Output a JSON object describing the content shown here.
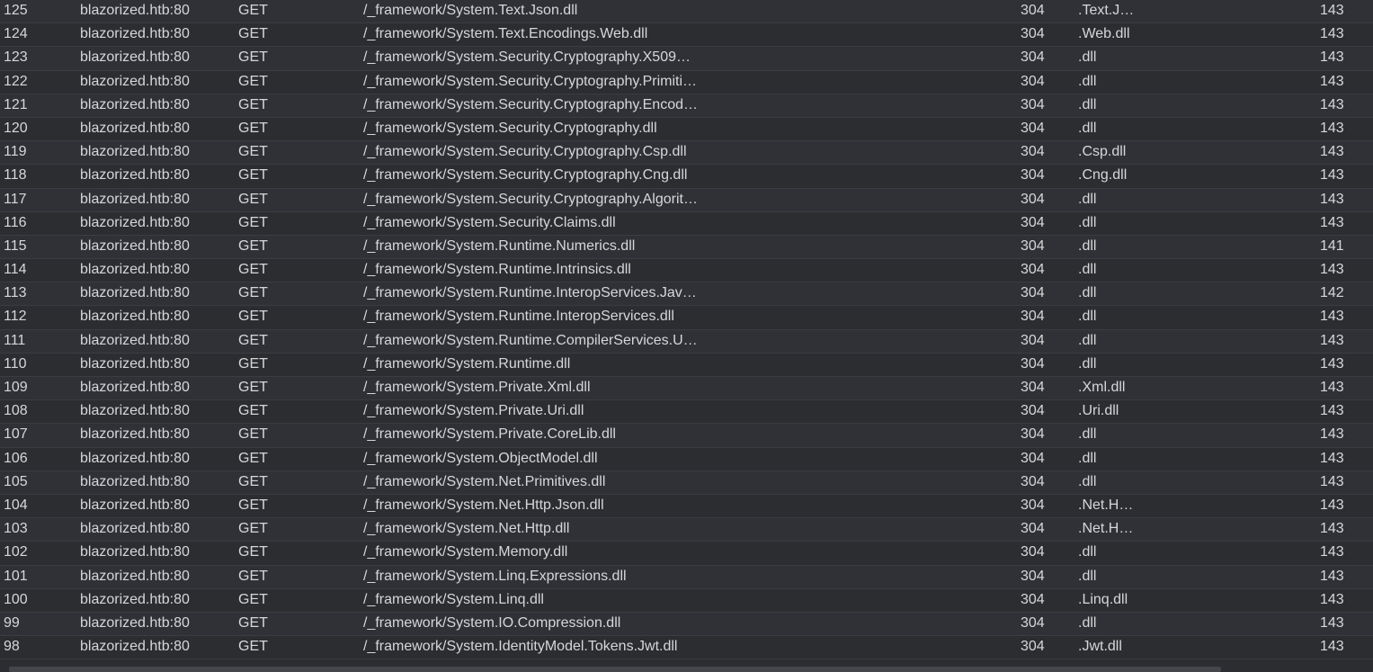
{
  "rows": [
    {
      "num": "125",
      "host": "blazorized.htb:80",
      "method": "GET",
      "url": "/_framework/System.Text.Json.dll",
      "status": "304",
      "ext": ".Text.J…",
      "length": "143"
    },
    {
      "num": "124",
      "host": "blazorized.htb:80",
      "method": "GET",
      "url": "/_framework/System.Text.Encodings.Web.dll",
      "status": "304",
      "ext": ".Web.dll",
      "length": "143"
    },
    {
      "num": "123",
      "host": "blazorized.htb:80",
      "method": "GET",
      "url": "/_framework/System.Security.Cryptography.X509…",
      "status": "304",
      "ext": ".dll",
      "length": "143"
    },
    {
      "num": "122",
      "host": "blazorized.htb:80",
      "method": "GET",
      "url": "/_framework/System.Security.Cryptography.Primiti…",
      "status": "304",
      "ext": ".dll",
      "length": "143"
    },
    {
      "num": "121",
      "host": "blazorized.htb:80",
      "method": "GET",
      "url": "/_framework/System.Security.Cryptography.Encod…",
      "status": "304",
      "ext": ".dll",
      "length": "143"
    },
    {
      "num": "120",
      "host": "blazorized.htb:80",
      "method": "GET",
      "url": "/_framework/System.Security.Cryptography.dll",
      "status": "304",
      "ext": ".dll",
      "length": "143"
    },
    {
      "num": "119",
      "host": "blazorized.htb:80",
      "method": "GET",
      "url": "/_framework/System.Security.Cryptography.Csp.dll",
      "status": "304",
      "ext": ".Csp.dll",
      "length": "143"
    },
    {
      "num": "118",
      "host": "blazorized.htb:80",
      "method": "GET",
      "url": "/_framework/System.Security.Cryptography.Cng.dll",
      "status": "304",
      "ext": ".Cng.dll",
      "length": "143"
    },
    {
      "num": "117",
      "host": "blazorized.htb:80",
      "method": "GET",
      "url": "/_framework/System.Security.Cryptography.Algorit…",
      "status": "304",
      "ext": ".dll",
      "length": "143"
    },
    {
      "num": "116",
      "host": "blazorized.htb:80",
      "method": "GET",
      "url": "/_framework/System.Security.Claims.dll",
      "status": "304",
      "ext": ".dll",
      "length": "143"
    },
    {
      "num": "115",
      "host": "blazorized.htb:80",
      "method": "GET",
      "url": "/_framework/System.Runtime.Numerics.dll",
      "status": "304",
      "ext": ".dll",
      "length": "141"
    },
    {
      "num": "114",
      "host": "blazorized.htb:80",
      "method": "GET",
      "url": "/_framework/System.Runtime.Intrinsics.dll",
      "status": "304",
      "ext": ".dll",
      "length": "143"
    },
    {
      "num": "113",
      "host": "blazorized.htb:80",
      "method": "GET",
      "url": "/_framework/System.Runtime.InteropServices.Jav…",
      "status": "304",
      "ext": ".dll",
      "length": "142"
    },
    {
      "num": "112",
      "host": "blazorized.htb:80",
      "method": "GET",
      "url": "/_framework/System.Runtime.InteropServices.dll",
      "status": "304",
      "ext": ".dll",
      "length": "143"
    },
    {
      "num": "111",
      "host": "blazorized.htb:80",
      "method": "GET",
      "url": "/_framework/System.Runtime.CompilerServices.U…",
      "status": "304",
      "ext": ".dll",
      "length": "143"
    },
    {
      "num": "110",
      "host": "blazorized.htb:80",
      "method": "GET",
      "url": "/_framework/System.Runtime.dll",
      "status": "304",
      "ext": ".dll",
      "length": "143"
    },
    {
      "num": "109",
      "host": "blazorized.htb:80",
      "method": "GET",
      "url": "/_framework/System.Private.Xml.dll",
      "status": "304",
      "ext": ".Xml.dll",
      "length": "143"
    },
    {
      "num": "108",
      "host": "blazorized.htb:80",
      "method": "GET",
      "url": "/_framework/System.Private.Uri.dll",
      "status": "304",
      "ext": ".Uri.dll",
      "length": "143"
    },
    {
      "num": "107",
      "host": "blazorized.htb:80",
      "method": "GET",
      "url": "/_framework/System.Private.CoreLib.dll",
      "status": "304",
      "ext": ".dll",
      "length": "143"
    },
    {
      "num": "106",
      "host": "blazorized.htb:80",
      "method": "GET",
      "url": "/_framework/System.ObjectModel.dll",
      "status": "304",
      "ext": ".dll",
      "length": "143"
    },
    {
      "num": "105",
      "host": "blazorized.htb:80",
      "method": "GET",
      "url": "/_framework/System.Net.Primitives.dll",
      "status": "304",
      "ext": ".dll",
      "length": "143"
    },
    {
      "num": "104",
      "host": "blazorized.htb:80",
      "method": "GET",
      "url": "/_framework/System.Net.Http.Json.dll",
      "status": "304",
      "ext": ".Net.H…",
      "length": "143"
    },
    {
      "num": "103",
      "host": "blazorized.htb:80",
      "method": "GET",
      "url": "/_framework/System.Net.Http.dll",
      "status": "304",
      "ext": ".Net.H…",
      "length": "143"
    },
    {
      "num": "102",
      "host": "blazorized.htb:80",
      "method": "GET",
      "url": "/_framework/System.Memory.dll",
      "status": "304",
      "ext": ".dll",
      "length": "143"
    },
    {
      "num": "101",
      "host": "blazorized.htb:80",
      "method": "GET",
      "url": "/_framework/System.Linq.Expressions.dll",
      "status": "304",
      "ext": ".dll",
      "length": "143"
    },
    {
      "num": "100",
      "host": "blazorized.htb:80",
      "method": "GET",
      "url": "/_framework/System.Linq.dll",
      "status": "304",
      "ext": ".Linq.dll",
      "length": "143"
    },
    {
      "num": "99",
      "host": "blazorized.htb:80",
      "method": "GET",
      "url": "/_framework/System.IO.Compression.dll",
      "status": "304",
      "ext": ".dll",
      "length": "143"
    },
    {
      "num": "98",
      "host": "blazorized.htb:80",
      "method": "GET",
      "url": "/_framework/System.IdentityModel.Tokens.Jwt.dll",
      "status": "304",
      "ext": ".Jwt.dll",
      "length": "143"
    }
  ]
}
